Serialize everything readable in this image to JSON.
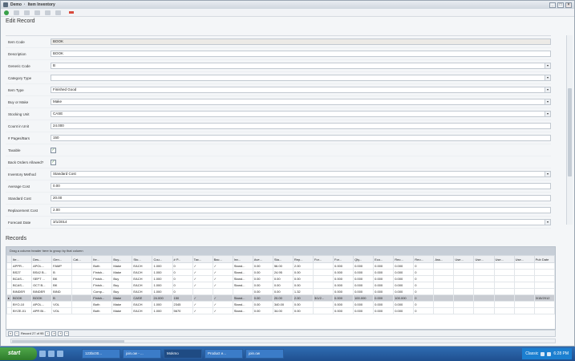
{
  "window": {
    "app": "Demo",
    "module": "Item Inventory",
    "min": "_",
    "max": "□",
    "close": "×"
  },
  "heading": "Edit Record",
  "form": [
    {
      "label": "Item Code",
      "value": "BOOK",
      "dropdown": false
    },
    {
      "label": "Description",
      "value": "BOOK",
      "dropdown": false
    },
    {
      "label": "Generic Code",
      "value": "B",
      "dropdown": true
    },
    {
      "label": "Category Type",
      "value": "",
      "dropdown": true
    },
    {
      "label": "Item Type",
      "value": "Finished Good",
      "dropdown": true
    },
    {
      "label": "Buy or Make",
      "value": "Make",
      "dropdown": true
    },
    {
      "label": "Stocking Unit",
      "value": "CASE",
      "dropdown": true
    },
    {
      "label": "Count in Unit",
      "value": "24.000",
      "dropdown": false
    },
    {
      "label": "# Pages/Bars",
      "value": "150",
      "dropdown": false
    },
    {
      "label": "Taxable",
      "checkbox": true
    },
    {
      "label": "Back Orders Allowed?",
      "checkbox": true
    },
    {
      "label": "Inventory Method",
      "value": "Standard Cost",
      "dropdown": true
    },
    {
      "label": "Average Cost",
      "value": "0.00",
      "dropdown": false
    },
    {
      "label": "Standard Cost",
      "value": "20.00",
      "dropdown": false
    },
    {
      "label": "Replacement Cost",
      "value": "2.00",
      "dropdown": false
    },
    {
      "label": "Forecast Date",
      "value": "3/1/2014",
      "dropdown": true
    }
  ],
  "records": {
    "label": "Records",
    "group_hint": "Drag a column header here to group by that column",
    "columns": [
      "Ite...",
      "Des...",
      "Gen...",
      "Cat...",
      "Ite...",
      "Buy...",
      "Sto...",
      "Cou...",
      "# P...",
      "Tax...",
      "Bac...",
      "Inv...",
      "Ave...",
      "Sta...",
      "Rep...",
      "For...",
      "For...",
      "Qty...",
      "Eco...",
      "Reo...",
      "Reo...",
      "Ass...",
      "Use...",
      "Use...",
      "Use...",
      "Use...",
      "Pub Date"
    ],
    "rows": [
      [
        "APPR...",
        "APOL...",
        "FAMP",
        "",
        "Both",
        "Make",
        "EACH",
        "1.000",
        "0",
        "✓",
        "✓",
        "Stand...",
        "0.00",
        "56.00",
        "2.00",
        "",
        "0.000",
        "0.000",
        "0.000",
        "0.000",
        "0",
        "",
        "",
        "",
        "",
        "",
        ""
      ],
      [
        "BS27",
        "BS42 B...",
        "B",
        "",
        "Finish...",
        "Make",
        "EACH",
        "1.000",
        "0",
        "✓",
        "✓",
        "Stand...",
        "0.00",
        "24.95",
        "0.00",
        "",
        "0.000",
        "0.000",
        "0.000",
        "0.000",
        "0",
        "",
        "",
        "",
        "",
        "",
        ""
      ],
      [
        "BCAS...",
        "SEPT ...",
        "BK",
        "",
        "Finish...",
        "Buy",
        "EACH",
        "1.000",
        "0",
        "✓",
        "✓",
        "Stand...",
        "0.00",
        "0.00",
        "0.00",
        "",
        "0.000",
        "0.000",
        "0.000",
        "0.000",
        "0",
        "",
        "",
        "",
        "",
        "",
        ""
      ],
      [
        "BCAS...",
        "OCT B...",
        "BK",
        "",
        "Finish...",
        "Buy",
        "EACH",
        "1.000",
        "0",
        "✓",
        "✓",
        "Stand...",
        "0.00",
        "0.00",
        "0.00",
        "",
        "0.000",
        "0.000",
        "0.000",
        "0.000",
        "0",
        "",
        "",
        "",
        "",
        "",
        ""
      ],
      [
        "BINDER",
        "BINDER",
        "BIND",
        "",
        "Comp...",
        "Buy",
        "EACH",
        "1.000",
        "0",
        "",
        "",
        "",
        "0.00",
        "0.00",
        "1.32",
        "",
        "0.000",
        "0.000",
        "0.000",
        "0.000",
        "0",
        "",
        "",
        "",
        "",
        "",
        ""
      ],
      [
        "BOOK",
        "BOOK",
        "B",
        "",
        "Finish...",
        "Make",
        "CASE",
        "24.000",
        "150",
        "✓",
        "✓",
        "Stand...",
        "0.00",
        "20.00",
        "2.00",
        "3/1/2...",
        "0.000",
        "100.000",
        "0.000",
        "100.000",
        "0",
        "",
        "",
        "",
        "",
        "",
        "3/15/2012"
      ],
      [
        "BYO-10",
        "APOL...",
        "VOL",
        "",
        "Both",
        "Make",
        "EACH",
        "1.000",
        "2345",
        "✓",
        "✓",
        "Stand...",
        "0.00",
        "340.00",
        "0.00",
        "",
        "0.000",
        "0.000",
        "0.000",
        "0.000",
        "0",
        "",
        "",
        "",
        "",
        "",
        ""
      ],
      [
        "BYZE-01",
        "APR Bl...",
        "VOL",
        "",
        "Both",
        "Make",
        "EACH",
        "1.000",
        "5670",
        "✓",
        "✓",
        "Stand...",
        "0.00",
        "34.00",
        "0.00",
        "",
        "0.000",
        "0.000",
        "0.000",
        "0.000",
        "0",
        "",
        "",
        "",
        "",
        "",
        ""
      ]
    ],
    "selected_row": 5,
    "pager_text": "Record 27 of 95"
  },
  "taskbar": {
    "start": "start",
    "items": [
      "123bc00...",
      "join.ow - ...",
      "Mokmo",
      "Product e...",
      "join.ow"
    ],
    "active_index": 2,
    "tray_label": "Classic",
    "time": "6:28 PM"
  }
}
